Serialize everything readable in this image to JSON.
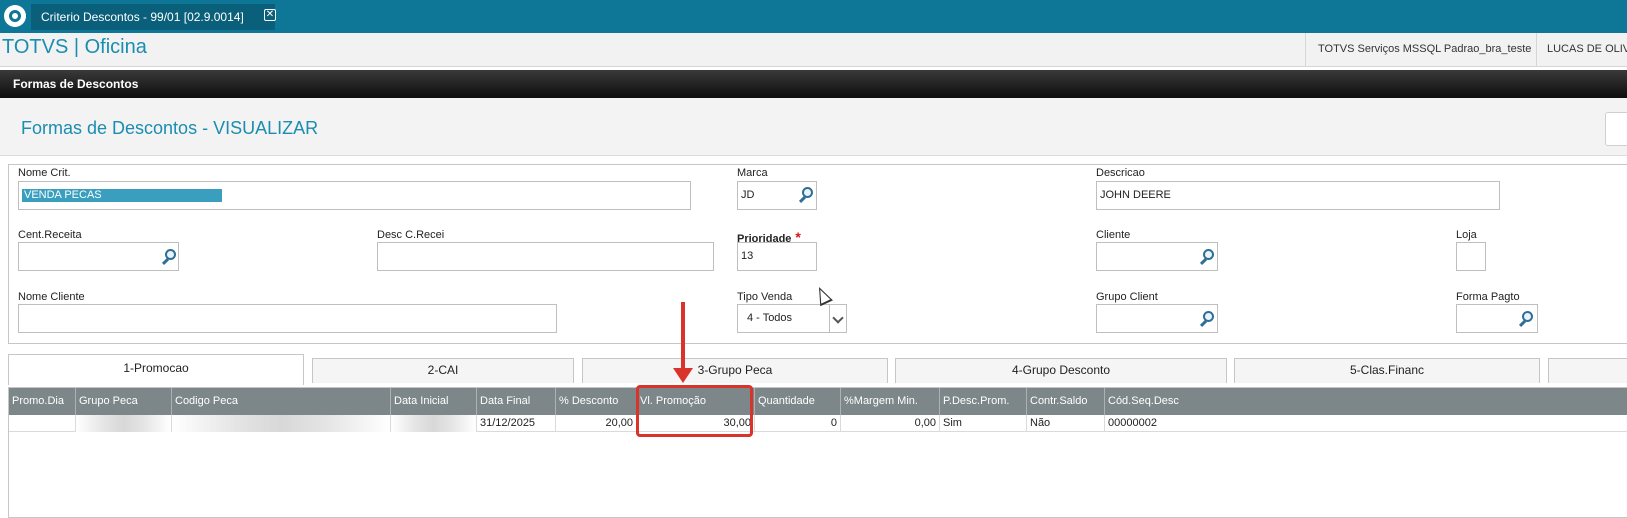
{
  "window": {
    "tab_title": "Criterio Descontos - 99/01 [02.9.0014]",
    "close_glyph": "✕"
  },
  "header": {
    "brand": "TOTVS | Oficina",
    "environment": "TOTVS Serviços MSSQL Padrao_bra_teste",
    "user": "LUCAS DE OLIVEIRA"
  },
  "section_title": "Formas de Descontos",
  "page_title": "Formas de Descontos - VISUALIZAR",
  "form": {
    "nome_crit": {
      "label": "Nome Crit.",
      "value": "VENDA PECAS"
    },
    "marca": {
      "label": "Marca",
      "value": "JD"
    },
    "descricao": {
      "label": "Descricao",
      "value": "JOHN DEERE"
    },
    "cent_receita": {
      "label": "Cent.Receita",
      "value": ""
    },
    "desc_c_recei": {
      "label": "Desc C.Recei",
      "value": ""
    },
    "prioridade": {
      "label": "Prioridade",
      "required_mark": "*",
      "value": "13"
    },
    "cliente": {
      "label": "Cliente",
      "value": ""
    },
    "loja": {
      "label": "Loja",
      "value": ""
    },
    "nome_cliente": {
      "label": "Nome Cliente",
      "value": ""
    },
    "tipo_venda": {
      "label": "Tipo Venda",
      "value": "4 - Todos"
    },
    "grupo_client": {
      "label": "Grupo Client",
      "value": ""
    },
    "forma_pagto": {
      "label": "Forma Pagto",
      "value": ""
    }
  },
  "tabs": [
    {
      "label": "1-Promocao",
      "active": true
    },
    {
      "label": "2-CAI",
      "active": false
    },
    {
      "label": "3-Grupo Peca",
      "active": false
    },
    {
      "label": "4-Grupo Desconto",
      "active": false
    },
    {
      "label": "5-Clas.Financ",
      "active": false
    },
    {
      "label": "",
      "active": false
    }
  ],
  "grid": {
    "columns": [
      "Promo.Dia",
      "Grupo Peca",
      "Codigo Peca",
      "Data Inicial",
      "Data Final",
      "% Desconto",
      "Vl. Promoção",
      "Quantidade",
      "%Margem Min.",
      "P.Desc.Prom.",
      "Contr.Saldo",
      "Cód.Seq.Desc"
    ],
    "rows": [
      [
        "",
        "",
        "",
        "",
        "31/12/2025",
        "20,00",
        "30,00",
        "0",
        "0,00",
        "Sim",
        "Não",
        "00000002"
      ]
    ]
  },
  "annotation_color": "#d9342b",
  "accent_color": "#1a8db0"
}
